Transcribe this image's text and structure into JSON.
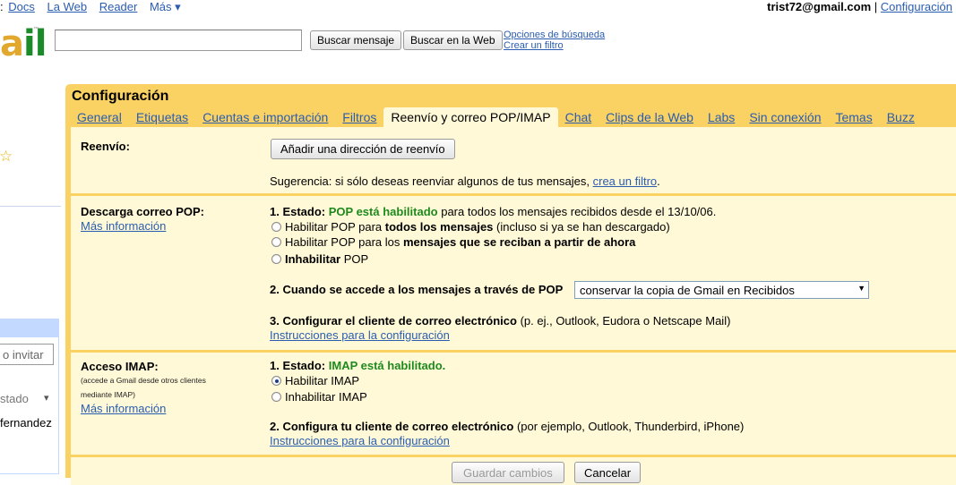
{
  "topnav": {
    "items": [
      "Docs",
      "La Web",
      "Reader",
      "Más ▾"
    ],
    "user_email": "trist72@gmail.com",
    "divider": "|",
    "settings_link": "Configuración"
  },
  "search": {
    "search_mail_button": "Buscar mensaje",
    "search_web_button": "Buscar en la Web",
    "options_link": "Opciones de búsqueda",
    "filter_link": "Crear un filtro"
  },
  "sidebar": {
    "invite_placeholder": "o invitar",
    "status_label": "stado",
    "status_arrow": "▾",
    "contact_name": "fernandez"
  },
  "settings": {
    "title": "Configuración",
    "tabs": [
      {
        "label": "General"
      },
      {
        "label": "Etiquetas"
      },
      {
        "label": "Cuentas e importación"
      },
      {
        "label": "Filtros"
      },
      {
        "label": "Reenvío y correo POP/IMAP"
      },
      {
        "label": "Chat"
      },
      {
        "label": "Clips de la Web"
      },
      {
        "label": "Labs"
      },
      {
        "label": "Sin conexión"
      },
      {
        "label": "Temas"
      },
      {
        "label": "Buzz"
      }
    ],
    "forwarding": {
      "label": "Reenvío:",
      "add_button": "Añadir una dirección de reenvío",
      "tip_prefix": "Sugerencia: si sólo deseas reenviar algunos de tus mensajes, ",
      "tip_link": "crea un filtro",
      "tip_suffix": "."
    },
    "pop": {
      "label": "Descarga correo POP:",
      "more_info": "Más información",
      "status_prefix": "1. Estado: ",
      "status_value": "POP está habilitado",
      "status_suffix": " para todos los mensajes recibidos desde el 13/10/06.",
      "opt1_a": "Habilitar POP para ",
      "opt1_b": "todos los mensajes",
      "opt1_c": " (incluso si ya se han descargado)",
      "opt2_a": "Habilitar POP para los ",
      "opt2_b": "mensajes que se reciban a partir de ahora",
      "opt3_a": "Inhabilitar",
      "opt3_b": " POP",
      "access_label": "2. Cuando se accede a los mensajes a través de POP",
      "access_select": "conservar la copia de Gmail en Recibidos",
      "client_label": "3. Configurar el cliente de correo electrónico",
      "client_suffix": " (p. ej., Outlook, Eudora o Netscape Mail)",
      "instructions": "Instrucciones para la configuración"
    },
    "imap": {
      "label": "Acceso IMAP:",
      "sub1": "(accede a Gmail desde otros clientes",
      "sub2": "mediante IMAP)",
      "more_info": "Más información",
      "status_prefix": "1. Estado: ",
      "status_value": "IMAP está habilitado.",
      "enable": "Habilitar IMAP",
      "disable": "Inhabilitar IMAP",
      "client_label": "2. Configura tu cliente de correo electrónico",
      "client_suffix": " (por ejemplo, Outlook, Thunderbird, iPhone)",
      "instructions": "Instrucciones para la configuración"
    },
    "footer": {
      "save_button": "Guardar cambios",
      "cancel_button": "Cancelar"
    }
  }
}
